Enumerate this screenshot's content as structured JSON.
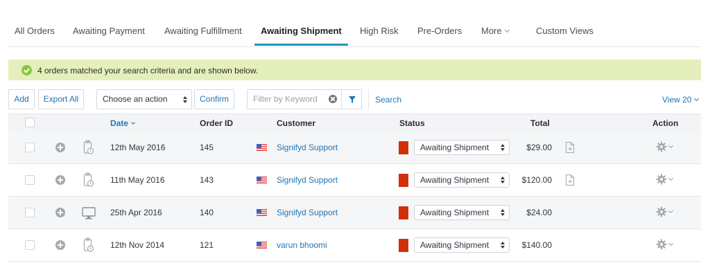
{
  "tabs": [
    {
      "label": "All Orders"
    },
    {
      "label": "Awaiting Payment"
    },
    {
      "label": "Awaiting Fulfillment"
    },
    {
      "label": "Awaiting Shipment",
      "active": true
    },
    {
      "label": "High Risk"
    },
    {
      "label": "Pre-Orders"
    },
    {
      "label": "More"
    },
    {
      "label": "Custom Views"
    }
  ],
  "alert": {
    "text": "4 orders matched your search criteria and are shown below.",
    "color": "#e4efbb"
  },
  "toolbar": {
    "add_label": "Add",
    "export_label": "Export All",
    "action_value": "Choose an action",
    "confirm_label": "Confirm",
    "keyword_placeholder": "Filter by Keyword",
    "search_label": "Search",
    "view_label": "View 20"
  },
  "table": {
    "headers": {
      "date": "Date",
      "order_id": "Order ID",
      "customer": "Customer",
      "status": "Status",
      "total": "Total",
      "action": "Action"
    },
    "rows": [
      {
        "date": "12th May 2016",
        "order_id": "145",
        "customer": "Signifyd Support",
        "status": "Awaiting Shipment",
        "total": "$29.00",
        "source_icon": "phone-order-icon",
        "has_doc": true
      },
      {
        "date": "11th May 2016",
        "order_id": "143",
        "customer": "Signifyd Support",
        "status": "Awaiting Shipment",
        "total": "$120.00",
        "source_icon": "phone-order-icon",
        "has_doc": true
      },
      {
        "date": "25th Apr 2016",
        "order_id": "140",
        "customer": "Signifyd Support",
        "status": "Awaiting Shipment",
        "total": "$24.00",
        "source_icon": "desktop-icon",
        "has_doc": false
      },
      {
        "date": "12th Nov 2014",
        "order_id": "121",
        "customer": "varun bhoomi",
        "status": "Awaiting Shipment",
        "total": "$140.00",
        "source_icon": "phone-order-icon",
        "has_doc": false
      }
    ]
  },
  "colors": {
    "accent": "#1f96b8",
    "link": "#1f74b5",
    "status_swatch": "#d0310a"
  }
}
